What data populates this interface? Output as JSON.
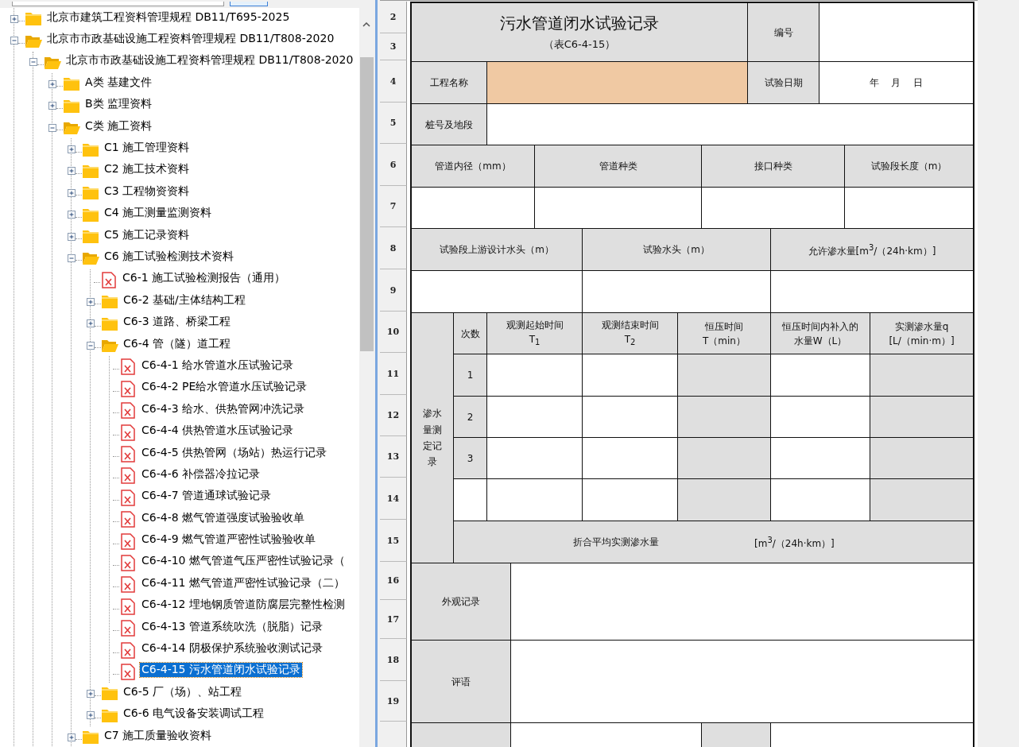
{
  "tree": [
    {
      "label": "北京市建筑工程资料管理规程 DB11/T695-2025",
      "kind": "folder",
      "expanded": false,
      "selected": false
    },
    {
      "label": "北京市市政基础设施工程资料管理规程 DB11/T808-2020",
      "kind": "folder",
      "expanded": true,
      "selected": false,
      "children": [
        {
          "label": "北京市市政基础设施工程资料管理规程 DB11/T808-2020",
          "kind": "folder",
          "expanded": true,
          "selected": false,
          "children": [
            {
              "label": "A类 基建文件",
              "kind": "folder",
              "expanded": false,
              "selected": false
            },
            {
              "label": "B类 监理资料",
              "kind": "folder",
              "expanded": false,
              "selected": false
            },
            {
              "label": "C类 施工资料",
              "kind": "folder",
              "expanded": true,
              "selected": false,
              "children": [
                {
                  "label": "C1 施工管理资料",
                  "kind": "folder",
                  "expanded": false,
                  "selected": false
                },
                {
                  "label": "C2 施工技术资料",
                  "kind": "folder",
                  "expanded": false,
                  "selected": false
                },
                {
                  "label": "C3 工程物资资料",
                  "kind": "folder",
                  "expanded": false,
                  "selected": false
                },
                {
                  "label": "C4 施工测量监测资料",
                  "kind": "folder",
                  "expanded": false,
                  "selected": false
                },
                {
                  "label": "C5 施工记录资料",
                  "kind": "folder",
                  "expanded": false,
                  "selected": false
                },
                {
                  "label": "C6 施工试验检测技术资料",
                  "kind": "folder",
                  "expanded": true,
                  "selected": false,
                  "children": [
                    {
                      "label": "C6-1 施工试验检测报告（通用）",
                      "kind": "file",
                      "selected": false
                    },
                    {
                      "label": "C6-2 基础/主体结构工程",
                      "kind": "folder",
                      "expanded": false,
                      "selected": false
                    },
                    {
                      "label": "C6-3 道路、桥梁工程",
                      "kind": "folder",
                      "expanded": false,
                      "selected": false
                    },
                    {
                      "label": "C6-4 管（隧）道工程",
                      "kind": "folder",
                      "expanded": true,
                      "selected": false,
                      "children": [
                        {
                          "label": "C6-4-1 给水管道水压试验记录",
                          "kind": "file",
                          "selected": false
                        },
                        {
                          "label": "C6-4-2 PE给水管道水压试验记录",
                          "kind": "file",
                          "selected": false
                        },
                        {
                          "label": "C6-4-3 给水、供热管网冲洗记录",
                          "kind": "file",
                          "selected": false
                        },
                        {
                          "label": "C6-4-4 供热管道水压试验记录",
                          "kind": "file",
                          "selected": false
                        },
                        {
                          "label": "C6-4-5 供热管网（场站）热运行记录",
                          "kind": "file",
                          "selected": false
                        },
                        {
                          "label": "C6-4-6 补偿器冷拉记录",
                          "kind": "file",
                          "selected": false
                        },
                        {
                          "label": "C6-4-7 管道通球试验记录",
                          "kind": "file",
                          "selected": false
                        },
                        {
                          "label": "C6-4-8 燃气管道强度试验验收单",
                          "kind": "file",
                          "selected": false
                        },
                        {
                          "label": "C6-4-9 燃气管道严密性试验验收单",
                          "kind": "file",
                          "selected": false
                        },
                        {
                          "label": "C6-4-10 燃气管道气压严密性试验记录（",
                          "kind": "file",
                          "selected": false
                        },
                        {
                          "label": "C6-4-11 燃气管道严密性试验记录（二）",
                          "kind": "file",
                          "selected": false
                        },
                        {
                          "label": "C6-4-12 埋地钢质管道防腐层完整性检测",
                          "kind": "file",
                          "selected": false
                        },
                        {
                          "label": "C6-4-13 管道系统吹洗（脱脂）记录",
                          "kind": "file",
                          "selected": false
                        },
                        {
                          "label": "C6-4-14 阴极保护系统验收测试记录",
                          "kind": "file",
                          "selected": false
                        },
                        {
                          "label": "C6-4-15 污水管道闭水试验记录",
                          "kind": "file",
                          "selected": true
                        }
                      ]
                    },
                    {
                      "label": "C6-5 厂（场）、站工程",
                      "kind": "folder",
                      "expanded": false,
                      "selected": false
                    },
                    {
                      "label": "C6-6 电气设备安装调试工程",
                      "kind": "folder",
                      "expanded": false,
                      "selected": false
                    }
                  ]
                },
                {
                  "label": "C7 施工质量验收资料",
                  "kind": "folder",
                  "expanded": false,
                  "selected": false
                }
              ]
            }
          ]
        }
      ]
    }
  ],
  "sheet": {
    "row_numbers": [
      "2",
      "3",
      "4",
      "5",
      "6",
      "7",
      "8",
      "9",
      "10",
      "11",
      "12",
      "13",
      "14",
      "15",
      "16",
      "17",
      "18",
      "19"
    ],
    "cells": [
      {
        "kind": "title",
        "lines": [
          "污水管道闭水试验记录",
          "（表C6-4-15）"
        ]
      },
      {
        "kind": "label",
        "lines": [
          "编号"
        ]
      },
      {
        "kind": "input"
      },
      {
        "kind": "label",
        "lines": [
          "工程名称"
        ]
      },
      {
        "kind": "highlighted_input"
      },
      {
        "kind": "label",
        "lines": [
          "试验日期"
        ]
      },
      {
        "kind": "input",
        "lines": [
          "年　 月　 日"
        ]
      },
      {
        "kind": "label",
        "lines": [
          "桩号及地段"
        ]
      },
      {
        "kind": "input"
      },
      {
        "kind": "label",
        "lines": [
          "管道内径（mm）"
        ]
      },
      {
        "kind": "label",
        "lines": [
          "管道种类"
        ]
      },
      {
        "kind": "label",
        "lines": [
          "接口种类"
        ]
      },
      {
        "kind": "label",
        "lines": [
          "试验段长度（m）"
        ]
      },
      {
        "kind": "input"
      },
      {
        "kind": "input"
      },
      {
        "kind": "input"
      },
      {
        "kind": "input"
      },
      {
        "kind": "label",
        "lines": [
          "试验段上游设计水头（m）"
        ]
      },
      {
        "kind": "label",
        "lines": [
          "试验水头（m）"
        ]
      },
      {
        "kind": "label",
        "lines": [
          "允许渗水量[m$^{3}$/（24h·km）]"
        ]
      },
      {
        "kind": "input"
      },
      {
        "kind": "input"
      },
      {
        "kind": "input"
      },
      {
        "kind": "vertical_label",
        "lines": [
          "渗水量测定记录"
        ]
      },
      {
        "kind": "label",
        "lines": [
          "次数"
        ]
      },
      {
        "kind": "label",
        "lines": [
          "观测起始时间",
          "T$_{1}$"
        ]
      },
      {
        "kind": "label",
        "lines": [
          "观测结束时间",
          "T$_{2}$"
        ]
      },
      {
        "kind": "label",
        "lines": [
          "恒压时间",
          "T（min）"
        ]
      },
      {
        "kind": "label",
        "lines": [
          "恒压时间内补入的",
          "水量W（L）"
        ]
      },
      {
        "kind": "label",
        "lines": [
          "实测渗水量q",
          "[L/（min·m）]"
        ]
      },
      {
        "kind": "label",
        "lines": [
          "1"
        ]
      },
      {
        "kind": "input"
      },
      {
        "kind": "input"
      },
      {
        "kind": "shaded_input"
      },
      {
        "kind": "input"
      },
      {
        "kind": "shaded_input"
      },
      {
        "kind": "label",
        "lines": [
          "2"
        ]
      },
      {
        "kind": "input"
      },
      {
        "kind": "input"
      },
      {
        "kind": "shaded_input"
      },
      {
        "kind": "input"
      },
      {
        "kind": "shaded_input"
      },
      {
        "kind": "label",
        "lines": [
          "3"
        ]
      },
      {
        "kind": "input"
      },
      {
        "kind": "input"
      },
      {
        "kind": "shaded_input"
      },
      {
        "kind": "input"
      },
      {
        "kind": "shaded_input"
      },
      {
        "kind": "input"
      },
      {
        "kind": "input"
      },
      {
        "kind": "input"
      },
      {
        "kind": "shaded_input"
      },
      {
        "kind": "input"
      },
      {
        "kind": "shaded_input"
      },
      {
        "kind": "split_label",
        "lines": [
          "折合平均实测渗水量",
          "[m$^{3}$/（24h·km）]"
        ]
      },
      {
        "kind": "label",
        "lines": [
          "外观记录"
        ]
      },
      {
        "kind": "input"
      },
      {
        "kind": "label",
        "lines": [
          "评语"
        ]
      },
      {
        "kind": "input"
      },
      {
        "kind": "label"
      },
      {
        "kind": "input"
      },
      {
        "kind": "label"
      },
      {
        "kind": "input"
      }
    ]
  }
}
